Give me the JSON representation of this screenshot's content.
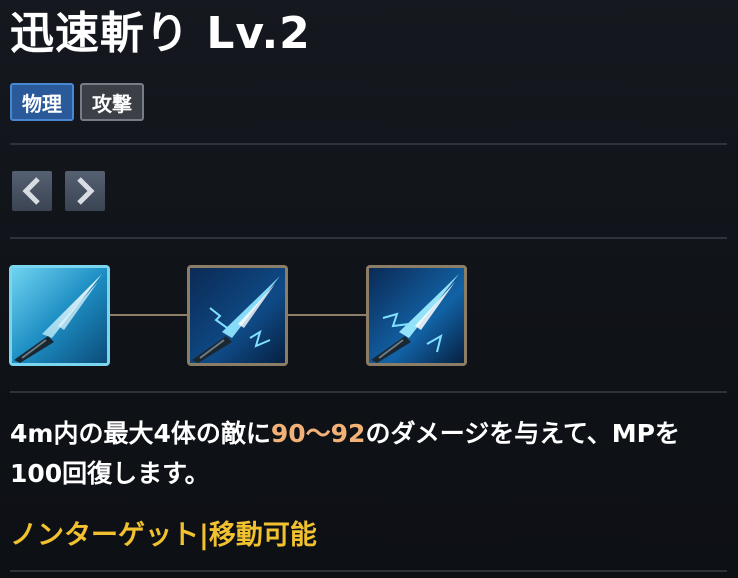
{
  "skill": {
    "title": "迅速斬り Lv.2",
    "tags": [
      "物理",
      "攻撃"
    ]
  },
  "navigation": {
    "prev_icon": "chevron-left-icon",
    "next_icon": "chevron-right-icon"
  },
  "levels": [
    {
      "level": 1,
      "state": "selected"
    },
    {
      "level": 2,
      "state": "normal"
    },
    {
      "level": 3,
      "state": "normal"
    }
  ],
  "description": {
    "before": "4m内の最大4体の敵に",
    "highlight": "90～92",
    "after": "のダメージを与えて、MPを100回復します。"
  },
  "footer": {
    "text": "ノンターゲット|移動可能"
  },
  "colors": {
    "highlight": "#f2b277",
    "footer": "#f2c12f",
    "tag_physical": "#2a5a9a",
    "tag_attack": "#3c4046",
    "selected_border": "#7ad6ee",
    "normal_border": "#8c7d66"
  }
}
